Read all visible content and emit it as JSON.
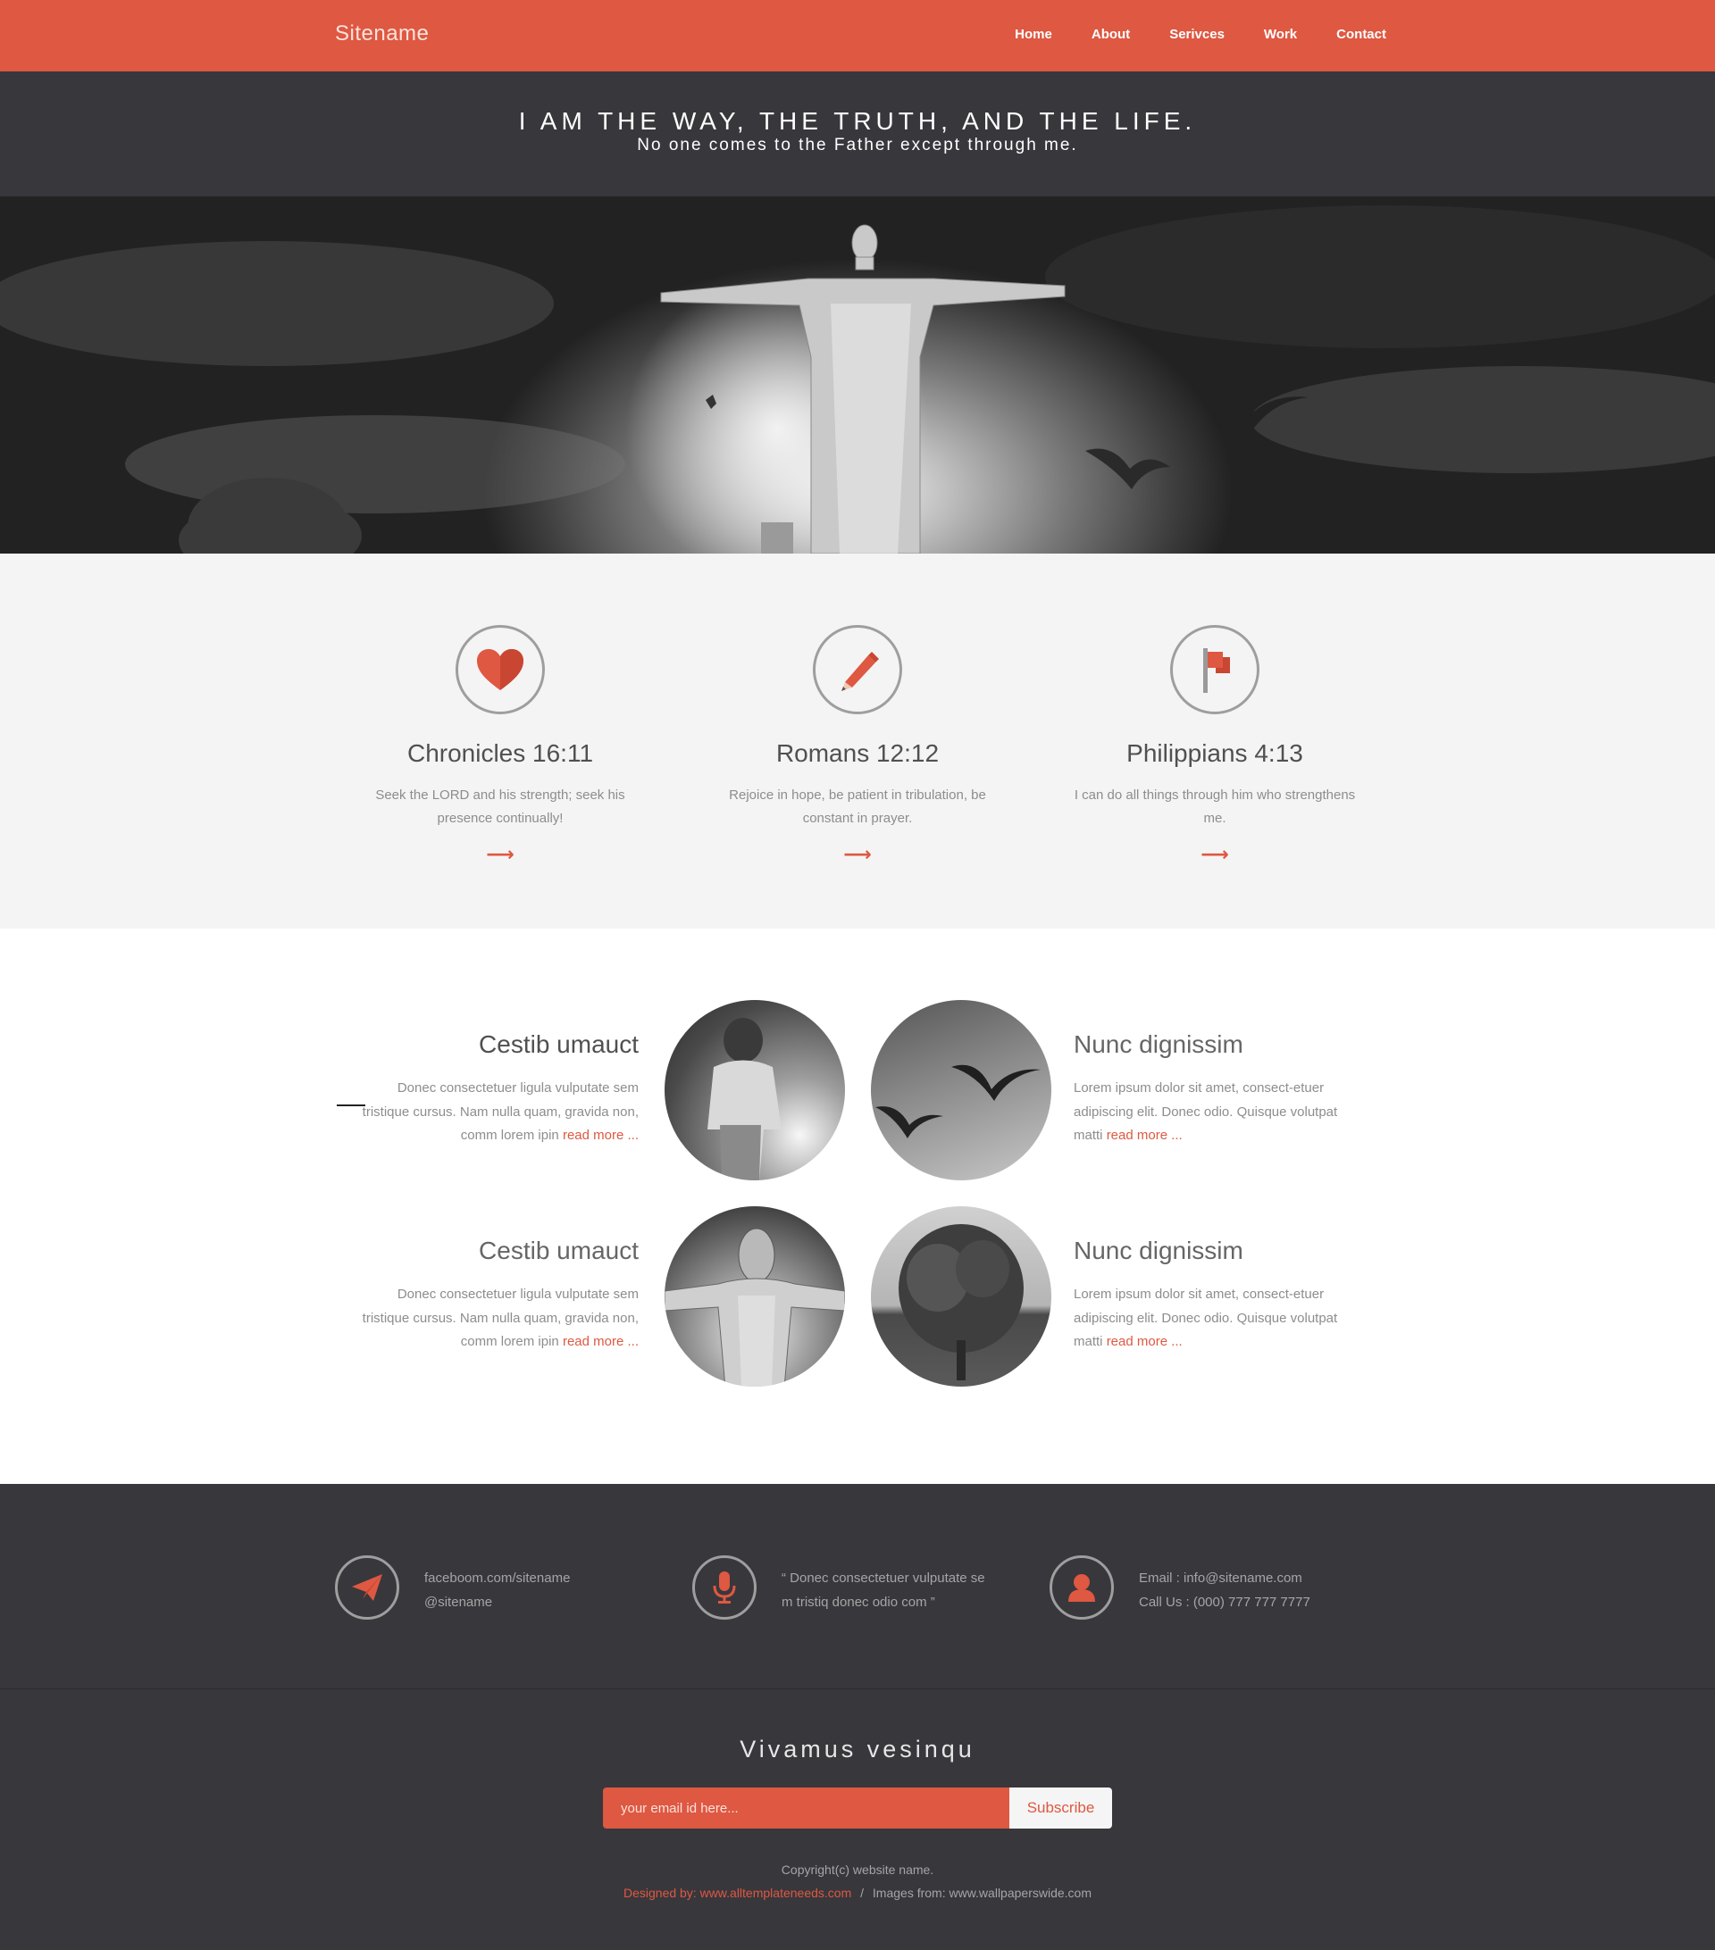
{
  "header": {
    "brand": "Sitename",
    "nav": [
      "Home",
      "About",
      "Serivces",
      "Work",
      "Contact"
    ]
  },
  "quote": {
    "main": "I AM THE WAY, THE TRUTH, AND THE LIFE.",
    "sub": "No one comes to the Father except through me."
  },
  "hero": {
    "image": "christ-the-redeemer-statue-with-birds"
  },
  "features": [
    {
      "icon": "heart-icon",
      "title": "Chronicles 16:11",
      "text": "Seek the LORD and his strength;  seek his presence continually!",
      "arrow": "⟶"
    },
    {
      "icon": "pencil-icon",
      "title": "Romans 12:12",
      "text": "Rejoice in hope, be patient in tribulation, be constant in prayer.",
      "arrow": "⟶"
    },
    {
      "icon": "flag-icon",
      "title": "Philippians 4:13",
      "text": "I can do all things through him who strengthens me.",
      "arrow": "⟶"
    }
  ],
  "articles": [
    {
      "title": "Cestib umauct",
      "text": "Donec consectetuer ligula vulputate sem tristique cursus. Nam nulla quam, gravida non, comm lorem ipin",
      "more": "read more ..."
    },
    {
      "title": "Nunc dignissim",
      "text": "Lorem ipsum dolor sit amet, consect-etuer adipiscing elit. Donec odio. Quisque volutpat matti",
      "more": "read more ..."
    },
    {
      "title": "Cestib umauct",
      "text": "Donec consectetuer ligula vulputate sem tristique cursus. Nam nulla quam, gravida non, comm lorem ipin",
      "more": "read more ..."
    },
    {
      "title": "Nunc dignissim",
      "text": "Lorem ipsum dolor sit amet, consect-etuer adipiscing elit. Donec odio. Quisque volutpat matti",
      "more": "read more ..."
    }
  ],
  "contact": [
    {
      "icon": "paper-plane-icon",
      "line1": "faceboom.com/sitename",
      "line2": "@sitename"
    },
    {
      "icon": "microphone-icon",
      "line1": "“ Donec consectetuer vulputate se",
      "line2": "m tristiq donec odio com ”"
    },
    {
      "icon": "user-icon",
      "line1": "Email : info@sitename.com",
      "line2": "Call Us : (000) 777 777 7777"
    }
  ],
  "newsletter": {
    "title": "Vivamus vesinqu",
    "placeholder": "your email id here...",
    "button": "Subscribe"
  },
  "footer": {
    "copyright": "Copyright(c) website name.",
    "designed": "Designed by: www.alltemplateneeds.com",
    "separator": "/",
    "images": "Images from: www.wallpaperswide.com"
  },
  "colors": {
    "accent": "#de5842",
    "dark": "#38373c",
    "light_bg": "#f4f4f4"
  }
}
